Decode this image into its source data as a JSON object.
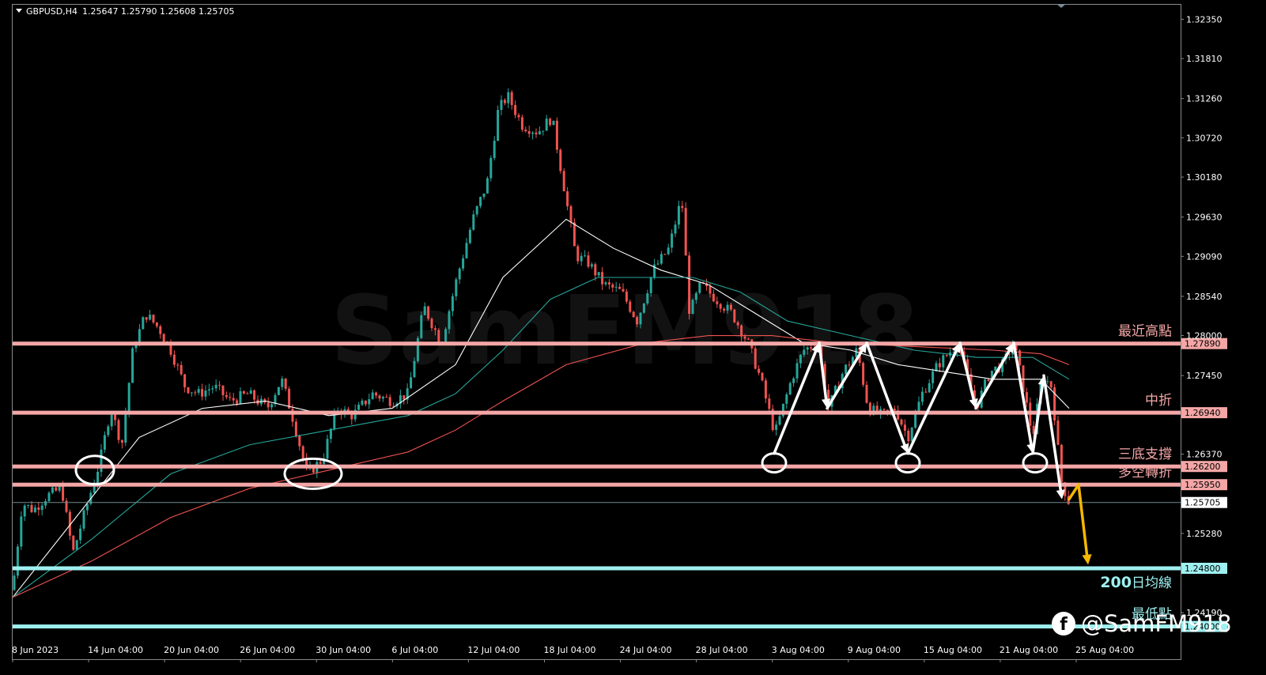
{
  "header": {
    "symbol": "GBPUSD,H4",
    "ohlc": "1.25647 1.25790 1.25608 1.25705"
  },
  "watermark": "SamFM918",
  "brand": "@SamFM918",
  "brand_icon": "facebook-icon",
  "colors": {
    "background": "#000000",
    "bull_candle": "#26a69a",
    "bear_candle": "#ef5350",
    "level_line": "#f4a6a6",
    "support_line": "#9ff0f0",
    "arrow_white": "#ffffff",
    "arrow_yellow": "#f5b800"
  },
  "chart_data": {
    "type": "candlestick",
    "symbol": "GBPUSD",
    "timeframe": "H4",
    "ylim": [
      1.2355,
      1.3255
    ],
    "y_ticks": [
      "1.32350",
      "1.31810",
      "1.31260",
      "1.30720",
      "1.30180",
      "1.29630",
      "1.29090",
      "1.28540",
      "1.28000",
      "1.27450",
      "1.26370",
      "1.25280",
      "1.24190"
    ],
    "x_ticks": [
      "8 Jun 2023",
      "14 Jun 04:00",
      "20 Jun 04:00",
      "26 Jun 04:00",
      "30 Jun 04:00",
      "6 Jul 04:00",
      "12 Jul 04:00",
      "18 Jul 04:00",
      "24 Jul 04:00",
      "28 Jul 04:00",
      "3 Aug 04:00",
      "9 Aug 04:00",
      "15 Aug 04:00",
      "21 Aug 04:00",
      "25 Aug 04:00"
    ],
    "price_path": [
      [
        0,
        1.245
      ],
      [
        12,
        1.257
      ],
      [
        26,
        1.256
      ],
      [
        44,
        1.258
      ],
      [
        62,
        1.259
      ],
      [
        76,
        1.25
      ],
      [
        92,
        1.256
      ],
      [
        110,
        1.2625
      ],
      [
        124,
        1.27
      ],
      [
        138,
        1.265
      ],
      [
        152,
        1.278
      ],
      [
        168,
        1.283
      ],
      [
        185,
        1.281
      ],
      [
        200,
        1.278
      ],
      [
        218,
        1.273
      ],
      [
        235,
        1.272
      ],
      [
        255,
        1.273
      ],
      [
        275,
        1.271
      ],
      [
        298,
        1.272
      ],
      [
        322,
        1.27
      ],
      [
        340,
        1.274
      ],
      [
        356,
        1.268
      ],
      [
        372,
        1.261
      ],
      [
        392,
        1.263
      ],
      [
        410,
        1.27
      ],
      [
        430,
        1.269
      ],
      [
        455,
        1.272
      ],
      [
        480,
        1.271
      ],
      [
        500,
        1.272
      ],
      [
        520,
        1.284
      ],
      [
        542,
        1.279
      ],
      [
        562,
        1.288
      ],
      [
        582,
        1.296
      ],
      [
        600,
        1.301
      ],
      [
        614,
        1.311
      ],
      [
        626,
        1.313
      ],
      [
        644,
        1.309
      ],
      [
        664,
        1.308
      ],
      [
        682,
        1.31
      ],
      [
        698,
        1.3
      ],
      [
        712,
        1.291
      ],
      [
        728,
        1.29
      ],
      [
        748,
        1.287
      ],
      [
        770,
        1.286
      ],
      [
        790,
        1.282
      ],
      [
        810,
        1.289
      ],
      [
        830,
        1.292
      ],
      [
        846,
        1.299
      ],
      [
        856,
        1.283
      ],
      [
        870,
        1.287
      ],
      [
        890,
        1.285
      ],
      [
        910,
        1.283
      ],
      [
        930,
        1.279
      ],
      [
        946,
        1.274
      ],
      [
        964,
        1.2665
      ],
      [
        985,
        1.274
      ],
      [
        1000,
        1.278
      ],
      [
        1018,
        1.279
      ],
      [
        1032,
        1.27
      ],
      [
        1050,
        1.275
      ],
      [
        1068,
        1.278
      ],
      [
        1082,
        1.27
      ],
      [
        1100,
        1.269
      ],
      [
        1116,
        1.27
      ],
      [
        1132,
        1.266
      ],
      [
        1150,
        1.272
      ],
      [
        1170,
        1.276
      ],
      [
        1196,
        1.279
      ],
      [
        1218,
        1.27
      ],
      [
        1236,
        1.275
      ],
      [
        1252,
        1.276
      ],
      [
        1266,
        1.279
      ],
      [
        1276,
        1.274
      ],
      [
        1290,
        1.266
      ],
      [
        1302,
        1.2745
      ],
      [
        1314,
        1.273
      ],
      [
        1326,
        1.26
      ],
      [
        1336,
        1.257
      ]
    ],
    "moving_averages": [
      {
        "color": "#ffffff",
        "points": [
          [
            0,
            1.244
          ],
          [
            80,
            1.255
          ],
          [
            160,
            1.266
          ],
          [
            240,
            1.27
          ],
          [
            320,
            1.271
          ],
          [
            400,
            1.269
          ],
          [
            480,
            1.27
          ],
          [
            560,
            1.276
          ],
          [
            620,
            1.288
          ],
          [
            700,
            1.296
          ],
          [
            760,
            1.292
          ],
          [
            820,
            1.289
          ],
          [
            880,
            1.287
          ],
          [
            940,
            1.283
          ],
          [
            1000,
            1.279
          ],
          [
            1060,
            1.278
          ],
          [
            1120,
            1.276
          ],
          [
            1180,
            1.275
          ],
          [
            1240,
            1.274
          ],
          [
            1300,
            1.274
          ],
          [
            1336,
            1.27
          ]
        ]
      },
      {
        "color": "#26a69a",
        "points": [
          [
            0,
            1.244
          ],
          [
            100,
            1.252
          ],
          [
            200,
            1.261
          ],
          [
            300,
            1.265
          ],
          [
            400,
            1.267
          ],
          [
            500,
            1.269
          ],
          [
            560,
            1.272
          ],
          [
            620,
            1.278
          ],
          [
            680,
            1.285
          ],
          [
            740,
            1.288
          ],
          [
            800,
            1.288
          ],
          [
            860,
            1.288
          ],
          [
            920,
            1.286
          ],
          [
            980,
            1.282
          ],
          [
            1060,
            1.28
          ],
          [
            1140,
            1.278
          ],
          [
            1220,
            1.277
          ],
          [
            1290,
            1.277
          ],
          [
            1336,
            1.274
          ]
        ]
      },
      {
        "color": "#ef5350",
        "points": [
          [
            0,
            1.244
          ],
          [
            100,
            1.249
          ],
          [
            200,
            1.255
          ],
          [
            300,
            1.259
          ],
          [
            400,
            1.2615
          ],
          [
            500,
            1.264
          ],
          [
            560,
            1.267
          ],
          [
            620,
            1.271
          ],
          [
            700,
            1.276
          ],
          [
            800,
            1.279
          ],
          [
            880,
            1.28
          ],
          [
            960,
            1.28
          ],
          [
            1040,
            1.279
          ],
          [
            1140,
            1.2785
          ],
          [
            1240,
            1.278
          ],
          [
            1300,
            1.2775
          ],
          [
            1336,
            1.276
          ]
        ]
      }
    ],
    "levels": [
      {
        "price": 1.2789,
        "price_label": "1.27890",
        "label": "最近高點",
        "color": "#f4a6a6"
      },
      {
        "price": 1.2694,
        "price_label": "1.26940",
        "label": "中折",
        "color": "#f4a6a6"
      },
      {
        "price": 1.262,
        "price_label": "1.26200",
        "label": "三底支撐",
        "color": "#f4a6a6"
      },
      {
        "price": 1.2595,
        "price_label": "1.25950",
        "label": "多空轉折",
        "color": "#f4a6a6"
      },
      {
        "price": 1.248,
        "price_label": "1.24800",
        "label_number": "200",
        "label": "日均線",
        "color": "#9ff0f0"
      },
      {
        "price": 1.24,
        "price_label": "1.24000",
        "label": "最低點",
        "color": "#9ff0f0"
      }
    ],
    "current_price": {
      "price": 1.25705,
      "label": "1.25705"
    },
    "circles": [
      {
        "x": 104,
        "price": 1.2615
      },
      {
        "x": 380,
        "price": 1.261
      },
      {
        "x": 963,
        "price": 1.2625
      },
      {
        "x": 1132,
        "price": 1.2625
      },
      {
        "x": 1293,
        "price": 1.2625
      }
    ],
    "zigzag": [
      [
        963,
        1.2638
      ],
      [
        1020,
        1.279
      ],
      [
        1030,
        1.27
      ],
      [
        1080,
        1.279
      ],
      [
        1132,
        1.2638
      ],
      [
        1198,
        1.279
      ],
      [
        1218,
        1.27
      ],
      [
        1266,
        1.279
      ],
      [
        1290,
        1.2638
      ],
      [
        1304,
        1.2745
      ],
      [
        1327,
        1.2575
      ]
    ],
    "projection": [
      [
        1336,
        1.2575
      ],
      [
        1348,
        1.2595
      ],
      [
        1360,
        1.2485
      ]
    ]
  }
}
